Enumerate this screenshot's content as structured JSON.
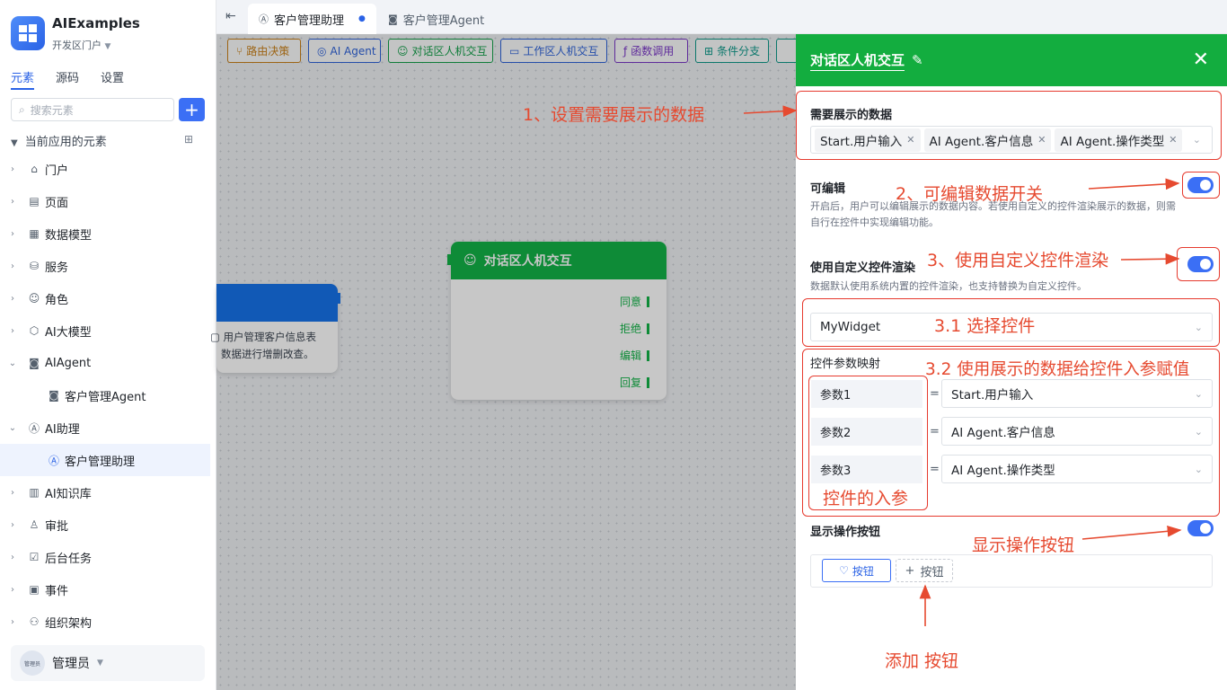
{
  "app": {
    "name": "AIExamples",
    "portal": "开发区门户"
  },
  "sidebar": {
    "tabs": [
      "元素",
      "源码",
      "设置"
    ],
    "search_placeholder": "搜索元素",
    "add_label": "+",
    "section": "当前应用的元素",
    "items": [
      {
        "label": "门户",
        "icon": "home-icon"
      },
      {
        "label": "页面",
        "icon": "page-icon"
      },
      {
        "label": "数据模型",
        "icon": "table-icon"
      },
      {
        "label": "服务",
        "icon": "database-icon"
      },
      {
        "label": "角色",
        "icon": "role-icon"
      },
      {
        "label": "AI大模型",
        "icon": "cube-icon"
      },
      {
        "label": "AIAgent",
        "icon": "robot-icon"
      },
      {
        "label": "客户管理Agent",
        "icon": "robot-icon"
      },
      {
        "label": "AI助理",
        "icon": "ai-icon"
      },
      {
        "label": "客户管理助理",
        "icon": "ai-icon"
      },
      {
        "label": "AI知识库",
        "icon": "book-icon"
      },
      {
        "label": "审批",
        "icon": "stamp-icon"
      },
      {
        "label": "后台任务",
        "icon": "task-icon"
      },
      {
        "label": "事件",
        "icon": "event-icon"
      },
      {
        "label": "组织架构",
        "icon": "org-icon"
      }
    ],
    "user": {
      "name": "管理员",
      "avatar_text": "管理员"
    }
  },
  "editor_tabs": [
    {
      "label": "客户管理助理",
      "dot": "●"
    },
    {
      "label": "客户管理Agent"
    }
  ],
  "toolbar": [
    "路由决策",
    "AI Agent",
    "对话区人机交互",
    "工作区人机交互",
    "函数调用",
    "条件分支"
  ],
  "toolbar_colors": [
    "#c9811a",
    "#2f63d9",
    "#14a04a",
    "#2f63d9",
    "#7a38c7",
    "#0f9a8a"
  ],
  "canvas": {
    "main_node": {
      "title": "对话区人机交互",
      "ports": [
        "同意",
        "拒绝",
        "编辑",
        "回复"
      ]
    },
    "left_node": {
      "text1": "用户管理客户信息表",
      "text2": "数据进行增删改查。"
    }
  },
  "panel": {
    "title": "对话区人机交互",
    "close": "✕",
    "data_label": "需要展示的数据",
    "data_tags": [
      "Start.用户输入",
      "AI Agent.客户信息",
      "AI Agent.操作类型"
    ],
    "editable_label": "可编辑",
    "editable_desc1": "开启后，用户可以编辑展示的数据内容。若使用自定义的控件渲染展示的数据，则需",
    "editable_desc2": "自行在控件中实现编辑功能。",
    "editable_on": true,
    "custom_label": "使用自定义控件渲染",
    "custom_desc": "数据默认使用系统内置的控件渲染，也支持替换为自定义控件。",
    "custom_on": true,
    "widget_value": "MyWidget",
    "mapping_label": "控件参数映射",
    "params": [
      {
        "name": "参数1",
        "value": "Start.用户输入"
      },
      {
        "name": "参数2",
        "value": "AI Agent.客户信息"
      },
      {
        "name": "参数3",
        "value": "AI Agent.操作类型"
      }
    ],
    "eq": "=",
    "show_buttons_label": "显示操作按钮",
    "show_buttons_on": true,
    "button_label": "按钮",
    "add_button_label": "按钮"
  },
  "annotations": {
    "a1": "1、设置需要展示的数据",
    "a2": "2、可编辑数据开关",
    "a3": "3、使用自定义控件渲染",
    "a31": "3.1 选择控件",
    "a32": "3.2 使用展示的数据给控件入参赋值",
    "params": "控件的入参",
    "show": "显示操作按钮",
    "add": "添加 按钮"
  }
}
